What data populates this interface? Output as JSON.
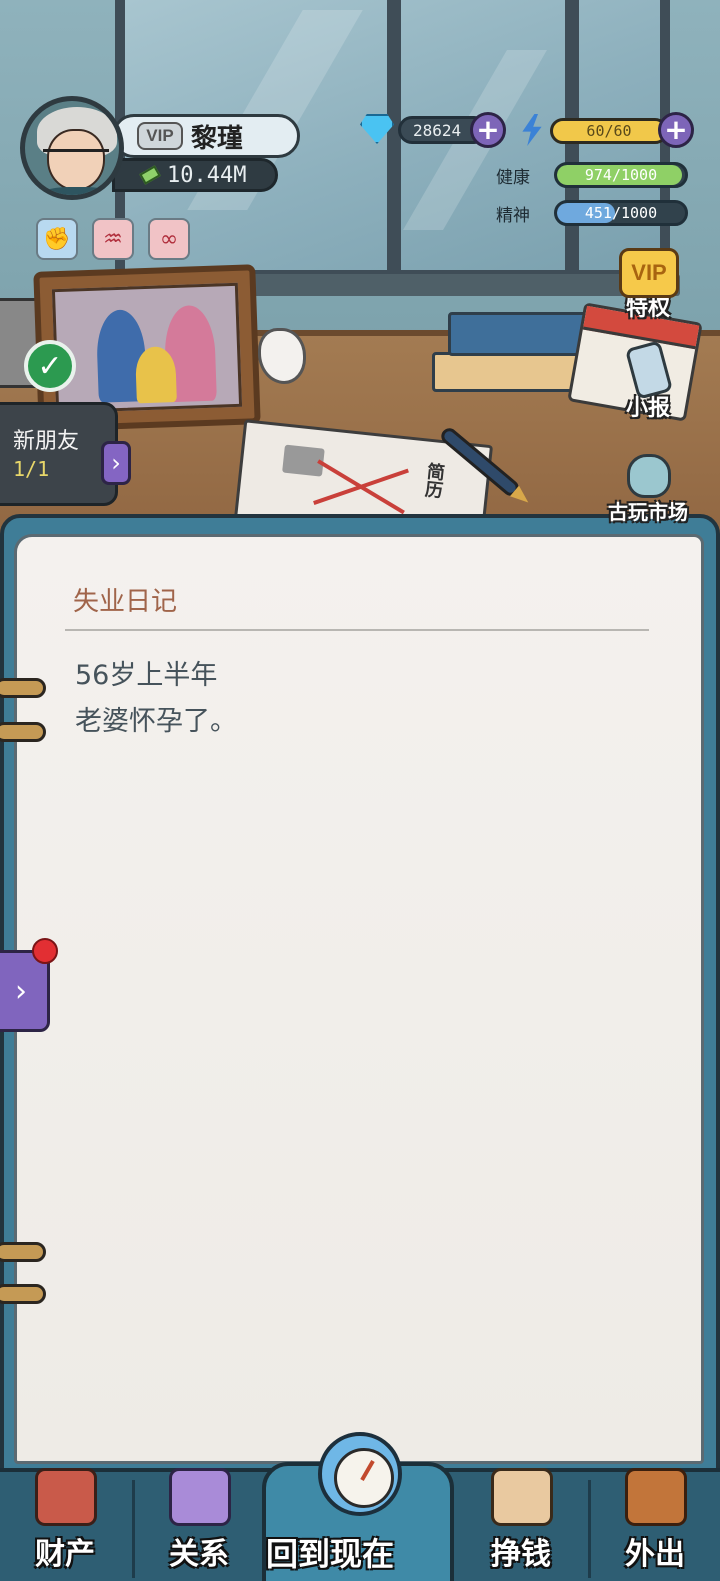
{
  "player": {
    "vip_label": "VIP",
    "name": "黎瑾",
    "money": "10.44M"
  },
  "status_icons": [
    "fist-icon",
    "lungs-icon",
    "stomach-icon"
  ],
  "currency": {
    "gems": "28624",
    "energy": "60/60",
    "energy_fraction": 1.0
  },
  "stats": {
    "health_label": "健康",
    "health_value": "974/1000",
    "health_fraction": 0.974,
    "health_color": "#8fd066",
    "spirit_label": "精神",
    "spirit_value": "451/1000",
    "spirit_fraction": 0.451,
    "spirit_color": "#6fa9de"
  },
  "side_buttons": {
    "vip_badge": "VIP",
    "privilege": "特权",
    "newspaper": "小报",
    "antique_market": "古玩市场"
  },
  "friend_tab": {
    "title": "新朋友",
    "count": "1/1"
  },
  "scene": {
    "resume_text": "简历"
  },
  "diary": {
    "title": "失业日记",
    "entries": [
      "56岁上半年",
      "老婆怀孕了。"
    ]
  },
  "nav": {
    "assets": "财产",
    "relations": "关系",
    "back_to_now": "回到现在",
    "earn_money": "挣钱",
    "go_out": "外出"
  },
  "colors": {
    "notebook": "#3f7d97",
    "page": "#f4f1ee",
    "nav": "#2e5e73",
    "accent_purple": "#8065be"
  }
}
